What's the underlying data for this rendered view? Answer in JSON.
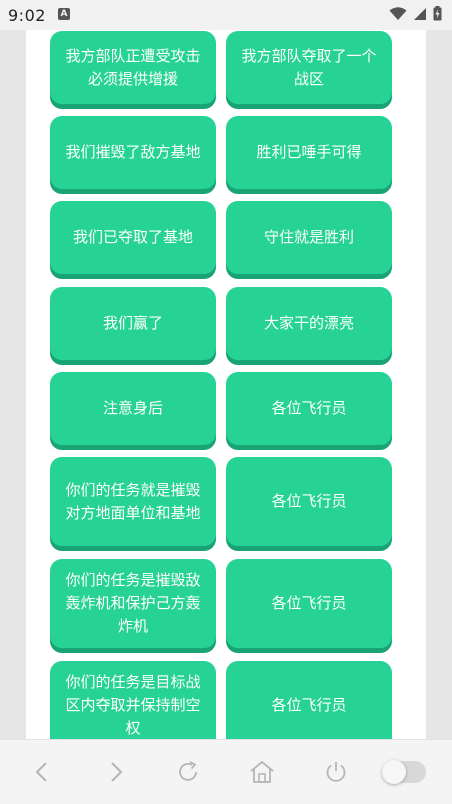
{
  "status_bar": {
    "time": "9:02",
    "notification_icon_letter": "A",
    "icons": [
      "wifi-icon",
      "signal-icon",
      "battery-charging-icon"
    ]
  },
  "buttons": [
    {
      "label": "我方部队正遭受攻击必须提供增援"
    },
    {
      "label": "我方部队夺取了一个战区"
    },
    {
      "label": "我们摧毁了敌方基地"
    },
    {
      "label": "胜利已唾手可得"
    },
    {
      "label": "我们已夺取了基地"
    },
    {
      "label": "守住就是胜利"
    },
    {
      "label": "我们赢了"
    },
    {
      "label": "大家干的漂亮"
    },
    {
      "label": "注意身后"
    },
    {
      "label": "各位飞行员"
    },
    {
      "label": "你们的任务就是摧毁对方地面单位和基地"
    },
    {
      "label": "各位飞行员"
    },
    {
      "label": "你们的任务是摧毁敌轰炸机和保护己方轰炸机"
    },
    {
      "label": "各位飞行员"
    },
    {
      "label": "你们的任务是目标战区内夺取并保持制空权"
    },
    {
      "label": "各位飞行员"
    }
  ],
  "nav_bar": {
    "icons": [
      "back-icon",
      "forward-icon",
      "refresh-icon",
      "home-icon",
      "power-icon"
    ],
    "toggle_state": "off"
  },
  "colors": {
    "button": "#26d395",
    "button_shadow": "#1aa374",
    "page_background": "#ffffff"
  }
}
